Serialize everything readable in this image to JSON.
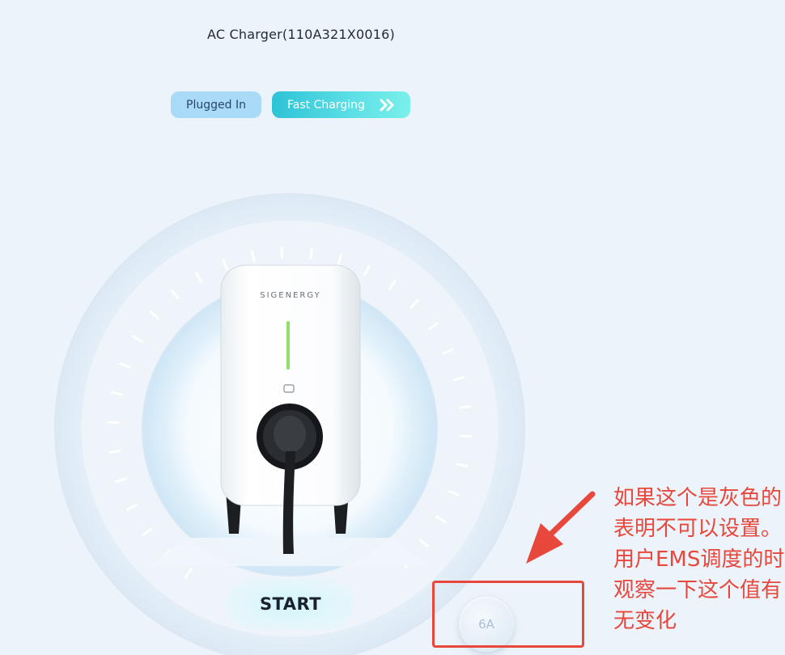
{
  "device": {
    "title": "AC Charger(110A321X0016)",
    "brand_logo": "SIGENERGY"
  },
  "status": {
    "plugged_label": "Plugged In",
    "charging_label": "Fast Charging",
    "charging_icon": "double-chevron-right-icon"
  },
  "controls": {
    "start_label": "START",
    "current_value": "6A",
    "current_state": "disabled"
  },
  "annotation": {
    "lines": [
      "如果这个是灰色的",
      "表明不可以设置。",
      "用户EMS调度的时",
      "观察一下这个值有",
      "无变化"
    ],
    "color": "#e8473c"
  },
  "colors": {
    "background": "#edf3fa",
    "plugged_badge": "#a9daf6",
    "charging_badge": "#2ec3d6",
    "led": "#8fe06a"
  }
}
